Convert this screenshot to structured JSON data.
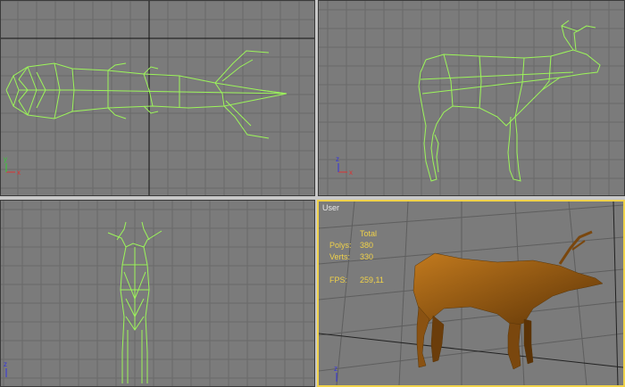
{
  "viewports": {
    "user": {
      "label": "User",
      "stats": {
        "total_header": "Total",
        "polys_label": "Polys:",
        "polys_value": "380",
        "verts_label": "Verts:",
        "verts_value": "330",
        "fps_label": "FPS:",
        "fps_value": "259,11"
      }
    }
  },
  "axes": {
    "x": "x",
    "y": "y",
    "z": "z"
  },
  "colors": {
    "background": "#7b7b7b",
    "grid": "#6a6a6a",
    "wireframe": "#9cf55a",
    "active_border": "#f0d24a",
    "model_shaded": "#a8661a"
  }
}
